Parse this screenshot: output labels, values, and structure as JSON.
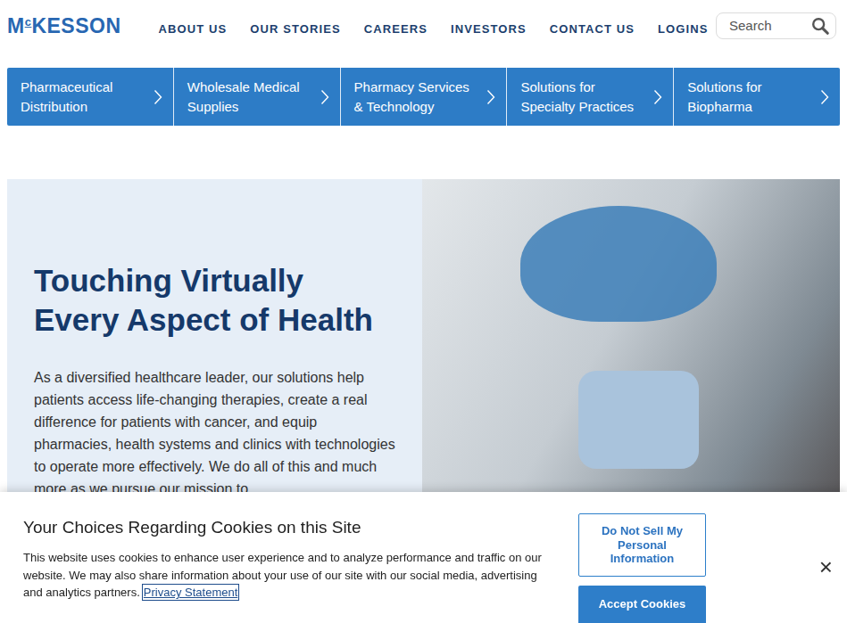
{
  "logo": {
    "first": "M",
    "raised": "c",
    "rest": "KESSON"
  },
  "nav": [
    {
      "label": "ABOUT US"
    },
    {
      "label": "OUR STORIES"
    },
    {
      "label": "CAREERS"
    },
    {
      "label": "INVESTORS"
    },
    {
      "label": "CONTACT US"
    },
    {
      "label": "LOGINS"
    }
  ],
  "search": {
    "placeholder": "Search"
  },
  "tabs": [
    {
      "lines": [
        "Pharmaceutical",
        "Distribution"
      ]
    },
    {
      "lines": [
        "Wholesale Medical",
        "Supplies"
      ]
    },
    {
      "lines": [
        "Pharmacy Services",
        "& Technology"
      ]
    },
    {
      "lines": [
        "Solutions for",
        "Specialty Practices"
      ]
    },
    {
      "lines": [
        "Solutions for",
        "Biopharma"
      ]
    }
  ],
  "hero": {
    "title_lines": [
      "Touching Virtually",
      "Every Aspect of Health"
    ],
    "body": "As a diversified healthcare leader, our solutions help patients access life-changing therapies, create a real difference for patients with cancer, and equip pharmacies, health systems and clinics with technologies to operate more effectively. We do all of this and much more as we pursue our mission to"
  },
  "cookie_banner": {
    "title": "Your Choices Regarding Cookies on this Site",
    "text": "This website uses cookies to enhance user experience and to analyze performance and traffic on our website. We may also share information about your use of our site with our social media, advertising and analytics partners.",
    "link": "Privacy Statement",
    "buttons": [
      {
        "label": "Do Not Sell My Personal Information",
        "kind": "outline"
      },
      {
        "label": "Accept Cookies",
        "kind": "fill"
      }
    ],
    "close": "×"
  }
}
